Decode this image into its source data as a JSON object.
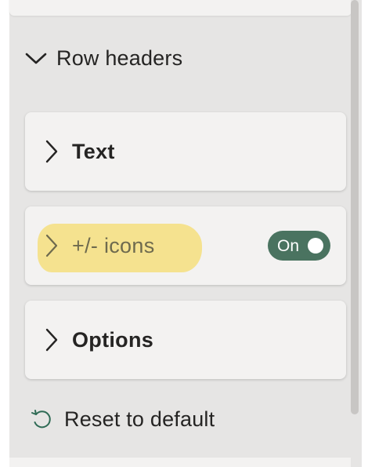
{
  "section": {
    "title": "Row headers",
    "expanded": true,
    "icon": "chevron-down-icon"
  },
  "cards": [
    {
      "label": "Text",
      "icon": "chevron-right-icon"
    },
    {
      "label": "+/- icons",
      "icon": "chevron-right-icon",
      "highlighted": true,
      "toggle": {
        "label": "On",
        "state": "on"
      }
    },
    {
      "label": "Options",
      "icon": "chevron-right-icon"
    }
  ],
  "reset": {
    "label": "Reset to default",
    "icon": "reset-icon"
  },
  "colors": {
    "pane_background": "#e6e5e4",
    "card_background": "#f3f2f1",
    "toggle_on": "#4a7360",
    "highlight": "#f4df7e",
    "reset_icon": "#2f6b55",
    "text": "#252423"
  }
}
